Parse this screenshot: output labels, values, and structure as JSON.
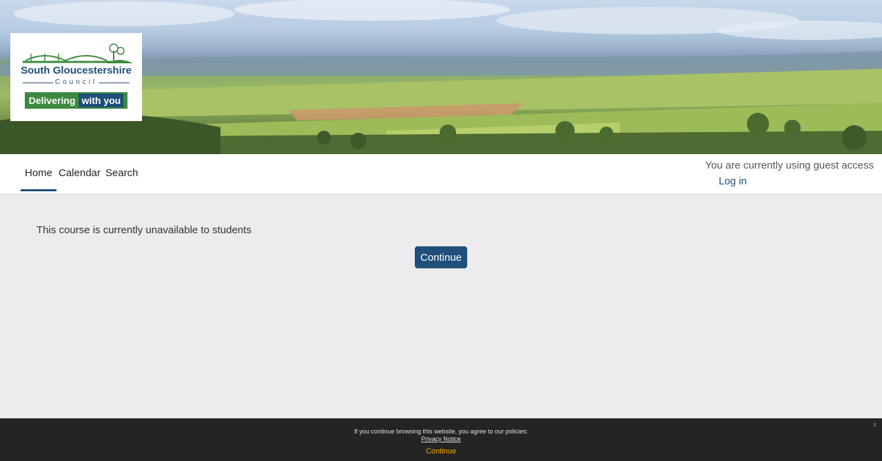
{
  "logo": {
    "title": "South Gloucestershire",
    "subtitle": "Council",
    "tag_part1": "Delivering",
    "tag_part2": "with you"
  },
  "nav": {
    "items": [
      {
        "label": "Home",
        "active": true
      },
      {
        "label": "Calendar",
        "active": false
      },
      {
        "label": "Search",
        "active": false
      }
    ],
    "guest_text": "You are currently using guest access",
    "login_label": "Log in"
  },
  "main": {
    "message": "This course is currently unavailable to students",
    "continue_label": "Continue"
  },
  "cookie": {
    "text": "If you continue browsing this website, you agree to our policies:",
    "link": "Privacy Notice",
    "continue_label": "Continue",
    "close_label": "x"
  },
  "colors": {
    "accent": "#1f4f7a",
    "cookie_bg": "#242424",
    "cookie_continue": "#f2a900",
    "page_bg": "#ececec"
  }
}
